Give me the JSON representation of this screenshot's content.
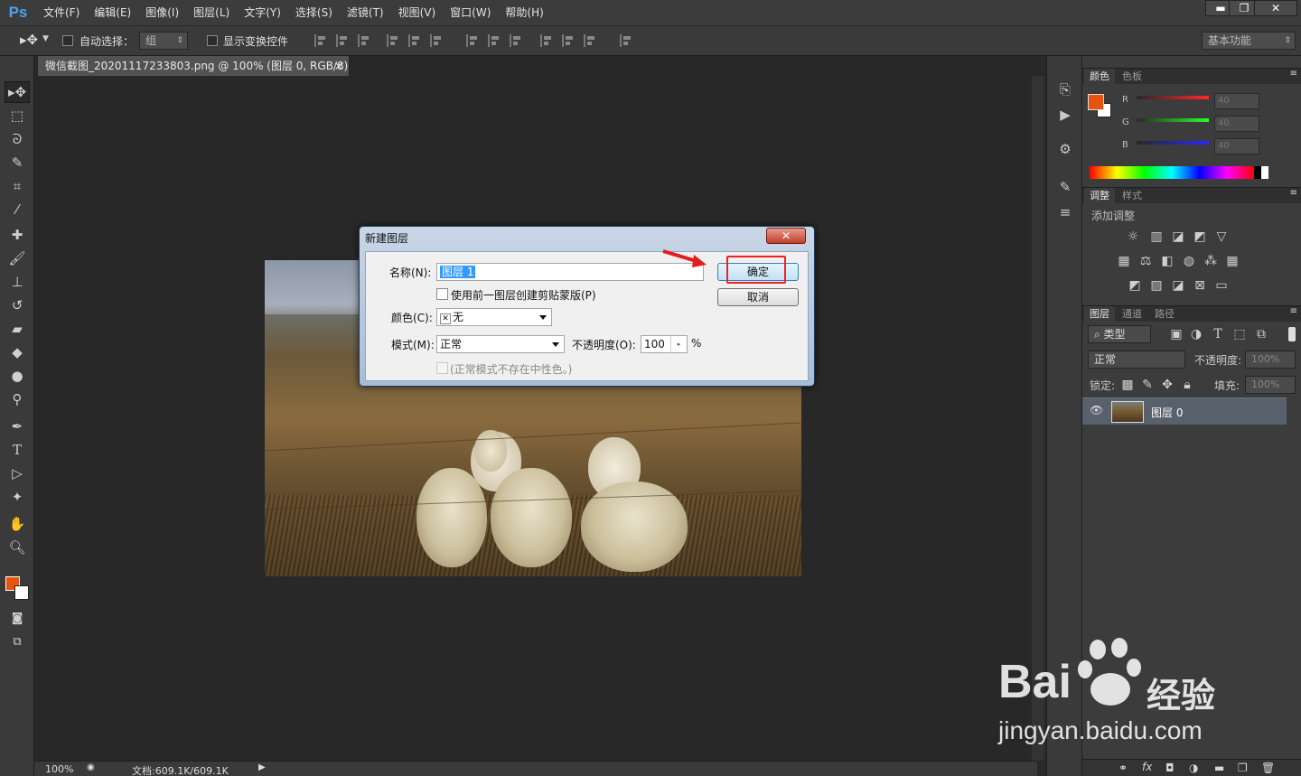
{
  "app": {
    "logo": "Ps"
  },
  "menu": [
    "文件(F)",
    "编辑(E)",
    "图像(I)",
    "图层(L)",
    "文字(Y)",
    "选择(S)",
    "滤镜(T)",
    "视图(V)",
    "窗口(W)",
    "帮助(H)"
  ],
  "window_buttons": {
    "minimize": "▬",
    "restore": "❐",
    "close": "✕"
  },
  "options": {
    "auto_select_label": "自动选择：",
    "auto_select_value": "组",
    "show_transform_label": "显示变换控件",
    "workspace": "基本功能"
  },
  "document": {
    "tab_title": "微信截图_20201117233803.png @ 100% (图层 0, RGB/8) *",
    "tab_close": "×",
    "zoom": "100%",
    "doc_size": "文档:609.1K/609.1K"
  },
  "color_panel": {
    "tabs": [
      "颜色",
      "色板"
    ],
    "channels": [
      {
        "label": "R",
        "value": "40"
      },
      {
        "label": "G",
        "value": "40"
      },
      {
        "label": "B",
        "value": "40"
      }
    ],
    "foreground": "#e8540e",
    "background": "#ffffff"
  },
  "adjust_panel": {
    "tabs": [
      "调整",
      "样式"
    ],
    "heading": "添加调整"
  },
  "layers_panel": {
    "tabs": [
      "图层",
      "通道",
      "路径"
    ],
    "filter_kind": "类型",
    "blend_mode": "正常",
    "opacity_label": "不透明度:",
    "opacity_value": "100%",
    "lock_label": "锁定:",
    "fill_label": "填充:",
    "fill_value": "100%",
    "layer_name": "图层 0"
  },
  "dialog": {
    "title": "新建图层",
    "close": "✕",
    "name_label": "名称(N):",
    "name_value": "图层 1",
    "clip_label": "使用前一图层创建剪贴蒙版(P)",
    "color_label": "颜色(C):",
    "color_value": "无",
    "mode_label": "模式(M):",
    "mode_value": "正常",
    "opacity_label": "不透明度(O):",
    "opacity_value": "100",
    "opacity_unit": "%",
    "neutral_label": "(正常模式不存在中性色。)",
    "ok": "确定",
    "cancel": "取消"
  },
  "watermark": {
    "brand": "Bai",
    "brand_cn": "经验",
    "url": "jingyan.baidu.com"
  }
}
